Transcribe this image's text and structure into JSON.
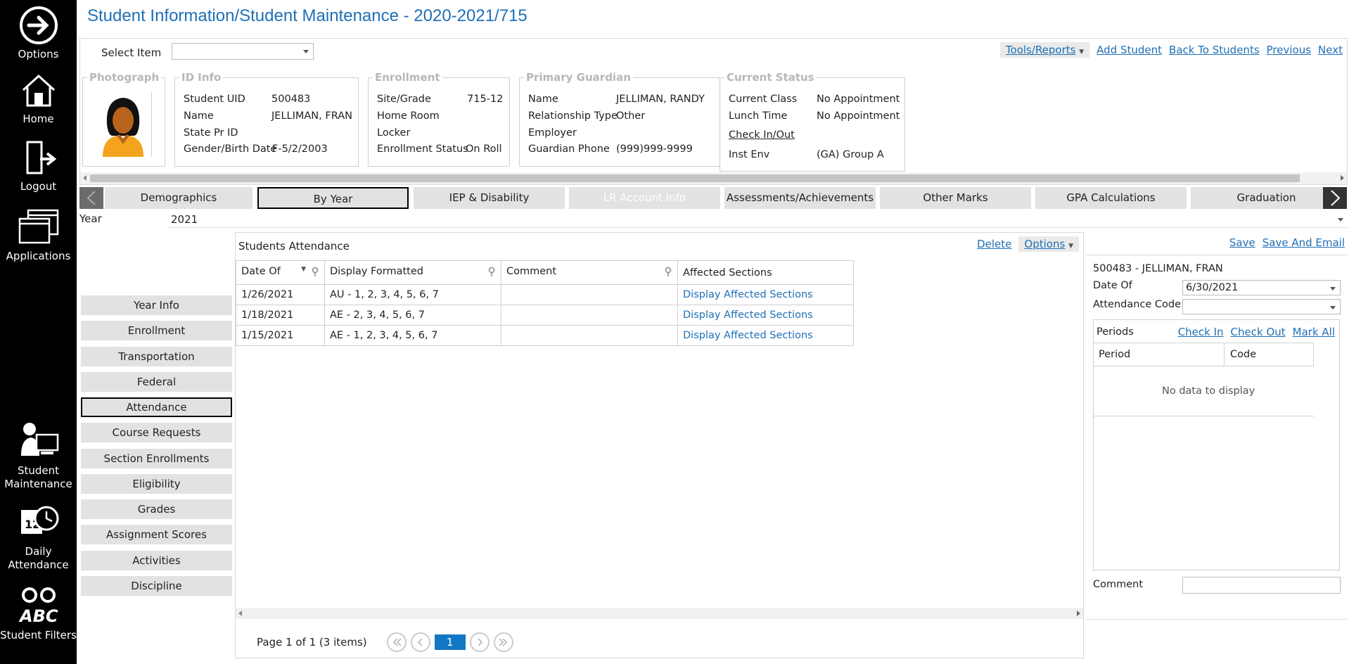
{
  "app_bar": {
    "items": [
      {
        "label": "Options",
        "icon": "arrow-right-circle-icon"
      },
      {
        "label": "Home",
        "icon": "house-icon"
      },
      {
        "label": "Logout",
        "icon": "door-exit-icon"
      },
      {
        "label": "Applications",
        "icon": "windows-icon"
      },
      {
        "label": "Student Maintenance",
        "icon": "student-computer-icon"
      },
      {
        "label": "Daily Attendance",
        "icon": "calendar-clock-icon"
      },
      {
        "label": "Student Filters",
        "icon": "binoculars-abc-icon"
      }
    ]
  },
  "page": {
    "title": "Student Information/Student Maintenance - 2020-2021/715"
  },
  "header": {
    "select_item_label": "Select Item",
    "select_item_value": "",
    "tools_reports": "Tools/Reports",
    "add_student": "Add Student",
    "back_to_students": "Back To Students",
    "previous": "Previous",
    "next": "Next"
  },
  "photograph": {
    "legend": "Photograph"
  },
  "id_info": {
    "legend": "ID Info",
    "student_uid_label": "Student UID",
    "student_uid": "500483",
    "name_label": "Name",
    "name": "JELLIMAN, FRAN",
    "state_pr_id_label": "State Pr ID",
    "state_pr_id": "",
    "gender_birth_label": "Gender/Birth Date",
    "gender_birth": "F-5/2/2003"
  },
  "enrollment": {
    "legend": "Enrollment",
    "site_grade_label": "Site/Grade",
    "site_grade": "715-12",
    "home_room_label": "Home Room",
    "home_room": "",
    "locker_label": "Locker",
    "locker": "",
    "status_label": "Enrollment Status",
    "status": "On Roll"
  },
  "guardian": {
    "legend": "Primary Guardian",
    "name_label": "Name",
    "name": "JELLIMAN, RANDY",
    "relationship_label": "Relationship Type",
    "relationship": "Other",
    "employer_label": "Employer",
    "employer": "",
    "phone_label": "Guardian Phone",
    "phone": "(999)999-9999"
  },
  "current_status": {
    "legend": "Current Status",
    "current_class_label": "Current Class",
    "current_class": "No Appointment",
    "lunch_time_label": "Lunch Time",
    "lunch_time": "No Appointment",
    "check_in_out": "Check In/Out",
    "inst_env_label": "Inst Env",
    "inst_env": "(GA) Group A"
  },
  "tabs": [
    {
      "label": "Demographics"
    },
    {
      "label": "By Year",
      "active": true
    },
    {
      "label": "IEP & Disability"
    },
    {
      "label": "LR Account Info",
      "disabled": true
    },
    {
      "label": "Assessments/Achievements"
    },
    {
      "label": "Other Marks"
    },
    {
      "label": "GPA Calculations"
    },
    {
      "label": "Graduation"
    }
  ],
  "year": {
    "label": "Year",
    "value": "2021"
  },
  "left_menu": [
    {
      "label": "Year Info"
    },
    {
      "label": "Enrollment"
    },
    {
      "label": "Transportation"
    },
    {
      "label": "Federal"
    },
    {
      "label": "Attendance",
      "active": true
    },
    {
      "label": "Course Requests"
    },
    {
      "label": "Section Enrollments"
    },
    {
      "label": "Eligibility"
    },
    {
      "label": "Grades"
    },
    {
      "label": "Assignment Scores"
    },
    {
      "label": "Activities"
    },
    {
      "label": "Discipline"
    }
  ],
  "grid": {
    "title": "Students Attendance",
    "delete": "Delete",
    "options": "Options",
    "columns": [
      "Date Of",
      "Display Formatted",
      "Comment",
      "Affected Sections"
    ],
    "rows": [
      {
        "date": "1/26/2021",
        "display": "AU - 1, 2, 3, 4, 5, 6, 7",
        "comment": "",
        "link": "Display Affected Sections"
      },
      {
        "date": "1/18/2021",
        "display": "AE - 2, 3, 4, 5, 6, 7",
        "comment": "",
        "link": "Display Affected Sections"
      },
      {
        "date": "1/15/2021",
        "display": "AE - 1, 2, 3, 4, 5, 6, 7",
        "comment": "",
        "link": "Display Affected Sections"
      }
    ],
    "pager_text": "Page 1 of 1 (3 items)",
    "current_page": "1"
  },
  "right_panel": {
    "save": "Save",
    "save_and_email": "Save And Email",
    "student": "500483 - JELLIMAN, FRAN",
    "date_of_label": "Date Of",
    "date_of_value": "6/30/2021",
    "attendance_code_label": "Attendance Code",
    "attendance_code_value": "",
    "periods_title": "Periods",
    "check_in": "Check In",
    "check_out": "Check Out",
    "mark_all": "Mark All",
    "period_col": "Period",
    "code_col": "Code",
    "no_data": "No data to display",
    "comment_label": "Comment",
    "comment_value": ""
  }
}
